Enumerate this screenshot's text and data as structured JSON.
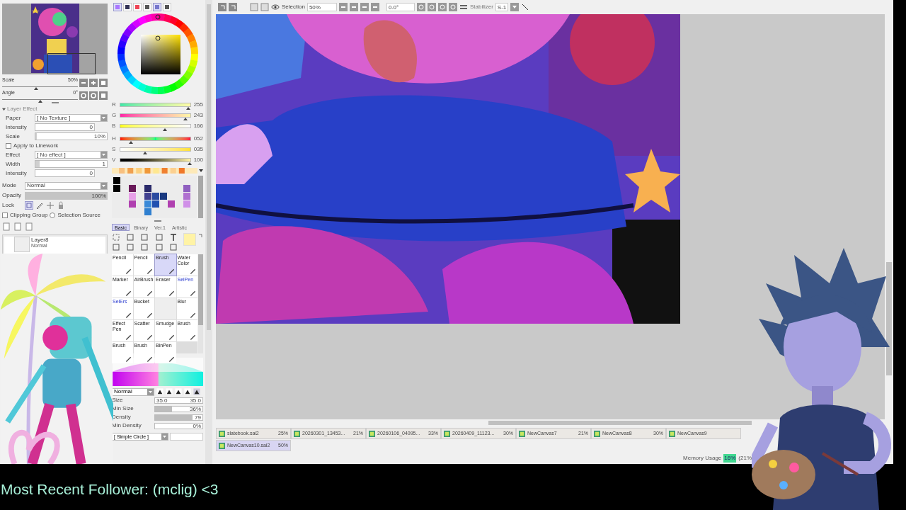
{
  "navigator": {
    "sliders": [
      {
        "label": "Scale",
        "reading": "50%",
        "level": 0.45
      },
      {
        "label": "Angle",
        "reading": "0°",
        "level": 0.5
      }
    ]
  },
  "layer_effect": {
    "title": "Layer Effect",
    "expanded": true,
    "rows": [
      {
        "kind": "dropdown",
        "label": "Paper",
        "value": "[ No Texture ]"
      },
      {
        "kind": "number",
        "label": "Intensity",
        "value": "0"
      },
      {
        "kind": "bar",
        "label": "Scale",
        "value": "10%",
        "level": 0.02
      },
      {
        "kind": "checkbox",
        "label": "Apply to Linework",
        "checked": false
      },
      {
        "kind": "dropdown",
        "label": "Effect",
        "value": "[ No effect ]"
      },
      {
        "kind": "bar",
        "label": "Width",
        "value": "1",
        "level": 0.06
      },
      {
        "kind": "number",
        "label": "Intensity",
        "value": "0"
      }
    ]
  },
  "layer_props": {
    "mode_label": "Mode",
    "mode": "Normal",
    "opacity": {
      "label": "Opacity",
      "reading": "100%",
      "level": 1
    },
    "lock_label": "Lock",
    "options": [
      {
        "kind": "checkbox",
        "label": "Clipping Group",
        "checked": false
      },
      {
        "kind": "radio",
        "label": "Selection Source",
        "checked": false
      }
    ]
  },
  "layers": [
    {
      "name": "Layer8",
      "mode": "Normal",
      "selected": false
    }
  ],
  "color": {
    "rgb": [
      {
        "label": "R",
        "reading": "255",
        "level": 0.97
      },
      {
        "label": "G",
        "reading": "243",
        "level": 0.93
      },
      {
        "label": "B",
        "reading": "166",
        "level": 0.64
      }
    ],
    "hsv": [
      {
        "label": "H",
        "reading": "052",
        "level": 0.15
      },
      {
        "label": "S",
        "reading": "035",
        "level": 0.35
      },
      {
        "label": "V",
        "reading": "100",
        "level": 0.99
      }
    ]
  },
  "tool_tabs": [
    {
      "label": "Basic",
      "selected": true
    },
    {
      "label": "Binary",
      "selected": false
    },
    {
      "label": "Ver.1",
      "selected": false
    },
    {
      "label": "Artistic",
      "selected": false
    }
  ],
  "brushes": [
    {
      "kind": "tool",
      "label": "Pencil",
      "selected": false
    },
    {
      "kind": "tool",
      "label": "Pencil",
      "selected": false
    },
    {
      "kind": "tool",
      "label": "Brush",
      "selected": true
    },
    {
      "kind": "tool",
      "label": "Water Color",
      "selected": false
    },
    {
      "kind": "tool",
      "label": "Marker",
      "selected": false
    },
    {
      "kind": "tool",
      "label": "AirBrush",
      "selected": false
    },
    {
      "kind": "tool",
      "label": "Eraser",
      "selected": false
    },
    {
      "kind": "selection",
      "label": "SelPen",
      "selected": false
    },
    {
      "kind": "selection",
      "label": "SelErs",
      "selected": false
    },
    {
      "kind": "tool",
      "label": "Bucket",
      "selected": false
    },
    {
      "kind": "empty",
      "selected": false
    },
    {
      "kind": "tool",
      "label": "Blur",
      "selected": false
    },
    {
      "kind": "tool",
      "label": "Effect Pen",
      "selected": false
    },
    {
      "kind": "tool",
      "label": "Scatter",
      "selected": false
    },
    {
      "kind": "tool",
      "label": "Smudge",
      "selected": false
    },
    {
      "kind": "tool",
      "label": "Brush",
      "selected": false
    },
    {
      "kind": "tool",
      "label": "Brush",
      "selected": false
    },
    {
      "kind": "tool",
      "label": "Brush",
      "selected": false
    },
    {
      "kind": "tool",
      "label": "BinPen",
      "selected": false
    }
  ],
  "brush_settings": {
    "mode": "Normal",
    "rows": [
      {
        "kind": "size",
        "label": "Size",
        "value": "35.0",
        "reading": "35.0"
      },
      {
        "kind": "bar",
        "label": "Min Size",
        "reading": "36%",
        "level": 0.36
      },
      {
        "kind": "bar",
        "label": "Density",
        "reading": "79",
        "level": 0.79
      },
      {
        "kind": "bar",
        "label": "Min Density",
        "reading": "0%",
        "level": 0
      }
    ],
    "shape": "[ Simple Circle ]"
  },
  "toolbar": {
    "selection": "Selection",
    "zoom": "50%",
    "angle": "0.0°",
    "stabilizer": "Stabilizer",
    "stabilizer_value": "S-1"
  },
  "canvas_tabs": [
    {
      "name": "slatebook.sai2",
      "zoom": "25%",
      "selected": false
    },
    {
      "name": "20260301_13453...",
      "zoom": "21%",
      "selected": false
    },
    {
      "name": "20260106_04095...",
      "zoom": "33%",
      "selected": false
    },
    {
      "name": "20260409_11123...",
      "zoom": "30%",
      "selected": false
    },
    {
      "name": "NewCanvas7",
      "zoom": "21%",
      "selected": false
    },
    {
      "name": "NewCanvas8",
      "zoom": "30%",
      "selected": false
    },
    {
      "name": "NewCanvas9",
      "selected": false
    },
    {
      "name": "NewCanvas10.sai2",
      "zoom": "50%",
      "selected": true
    }
  ],
  "status_bar": {
    "memory_label": "Memory Usage",
    "memory": "16%",
    "memory_extra": "(21%"
  },
  "follower_banner": "Most Recent Follower: (mclig) <3"
}
